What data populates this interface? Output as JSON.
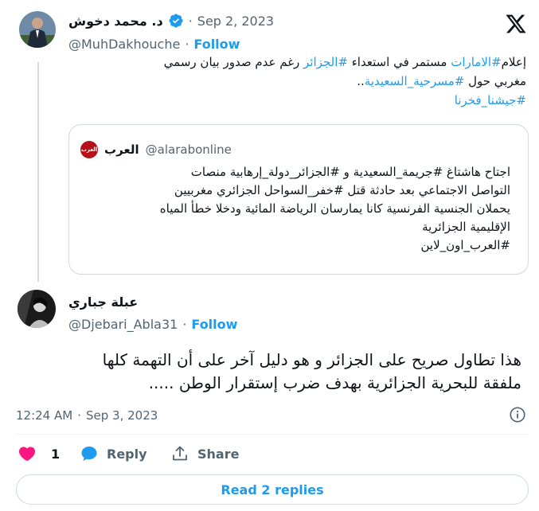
{
  "tweet": {
    "author_name": "د. محمد دخوش",
    "timestamp": "Sep 2, 2023",
    "handle": "@MuhDakhouche",
    "follow_label": "Follow",
    "text_line1_prefix": "إعلام",
    "text_line1_tag1": "#الامارات",
    "text_line1_mid": " مستمر في استعداء ",
    "text_line1_tag2": "#الجزائر",
    "text_line1_suffix": " رغم عدم صدور بيان رسمي",
    "text_line2_prefix": "مغربي حول ",
    "text_line2_tag": "#مسرحية_السعيدية",
    "text_line2_suffix": "..",
    "text_line3_tag": "#جيشنا_فخرنا"
  },
  "quote": {
    "author_name": "العرب",
    "handle": "@alarabonline",
    "logo_text": "العرب",
    "lines": [
      "اجتاح هاشتاغ #جريمة_السعيدية  و #الجزائر_دولة_إرهابية منصات",
      "التواصل الاجتماعي بعد حادثة قتل #خفر_السواحل الجزائري مغربيين",
      "يحملان الجنسية الفرنسية كانا يمارسان الرياضة المائية ودخلا خطأ المياه",
      "الإقليمية الجزائرية",
      "#العرب_اون_لاين"
    ]
  },
  "reply": {
    "author_name": "عبلة جباري",
    "handle": "@Djebari_Abla31",
    "follow_label": "Follow",
    "text_line1": "هذا تطاول صريح على الجزائر و هو دليل آخر على أن التهمة كلها",
    "text_line2": "ملفقة للبحرية الجزائرية بهدف ضرب إستقرار الوطن .....",
    "time": "12:24 AM",
    "date": "Sep 3, 2023",
    "like_count": "1",
    "reply_label": "Reply",
    "share_label": "Share"
  },
  "read_replies_label": "Read 2 replies",
  "colors": {
    "accent": "#1d9bf0",
    "like": "#f91880",
    "muted": "#536471",
    "border": "#cfd9de"
  },
  "icons": [
    "verified-badge-icon",
    "x-logo-icon",
    "info-icon",
    "heart-icon",
    "reply-icon",
    "share-icon"
  ]
}
